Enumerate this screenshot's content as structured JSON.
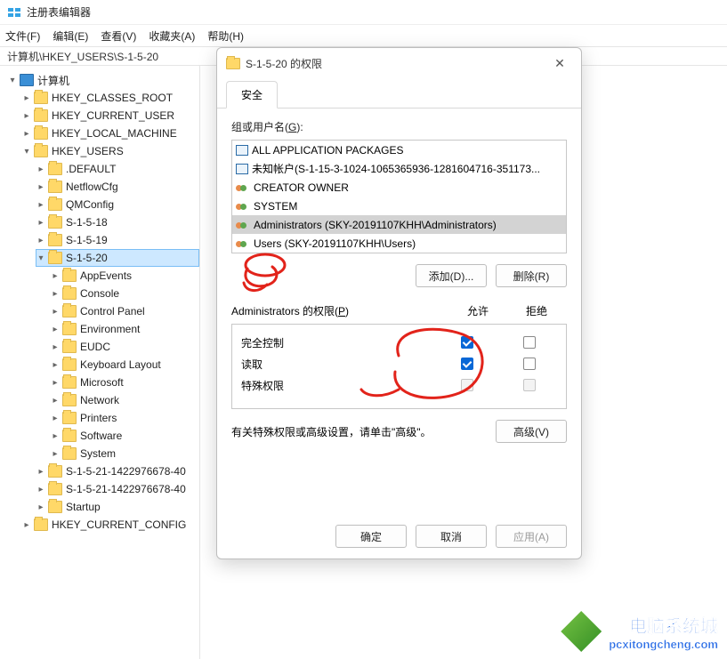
{
  "app": {
    "title": "注册表编辑器"
  },
  "menu": {
    "file": "文件(F)",
    "edit": "编辑(E)",
    "view": "查看(V)",
    "favorites": "收藏夹(A)",
    "help": "帮助(H)"
  },
  "path": "计算机\\HKEY_USERS\\S-1-5-20",
  "tree": {
    "root": "计算机",
    "hkcr": "HKEY_CLASSES_ROOT",
    "hkcu": "HKEY_CURRENT_USER",
    "hklm": "HKEY_LOCAL_MACHINE",
    "hku": "HKEY_USERS",
    "hku_children": [
      ".DEFAULT",
      "NetflowCfg",
      "QMConfig",
      "S-1-5-18",
      "S-1-5-19",
      "S-1-5-20"
    ],
    "s1520_children": [
      "AppEvents",
      "Console",
      "Control Panel",
      "Environment",
      "EUDC",
      "Keyboard Layout",
      "Microsoft",
      "Network",
      "Printers",
      "Software",
      "System"
    ],
    "hku_tail": [
      "S-1-5-21-1422976678-40",
      "S-1-5-21-1422976678-40",
      "Startup"
    ],
    "hkcc": "HKEY_CURRENT_CONFIG"
  },
  "dialog": {
    "title": "S-1-5-20 的权限",
    "tab_security": "安全",
    "group_label_prefix": "组或用户名(",
    "group_label_u": "G",
    "group_label_suffix": "):",
    "principals": [
      {
        "icon": "box",
        "text": "ALL APPLICATION PACKAGES"
      },
      {
        "icon": "box",
        "text": "未知帐户(S-1-15-3-1024-1065365936-1281604716-351173..."
      },
      {
        "icon": "group",
        "text": "CREATOR OWNER"
      },
      {
        "icon": "group",
        "text": "SYSTEM"
      },
      {
        "icon": "group",
        "text": "Administrators (SKY-20191107KHH\\Administrators)",
        "selected": true
      },
      {
        "icon": "group",
        "text": "Users (SKY-20191107KHH\\Users)"
      }
    ],
    "btn_add": "添加(D)...",
    "btn_remove": "删除(R)",
    "perm_header_prefix": "Administrators 的权限(",
    "perm_header_u": "P",
    "perm_header_suffix": ")",
    "col_allow": "允许",
    "col_deny": "拒绝",
    "perms": [
      {
        "name": "完全控制",
        "allow": true,
        "deny": false,
        "allow_dis": false,
        "deny_dis": false
      },
      {
        "name": "读取",
        "allow": true,
        "deny": false,
        "allow_dis": false,
        "deny_dis": false
      },
      {
        "name": "特殊权限",
        "allow": false,
        "deny": false,
        "allow_dis": true,
        "deny_dis": true
      }
    ],
    "adv_text": "有关特殊权限或高级设置，请单击\"高级\"。",
    "btn_advanced": "高级(V)",
    "btn_ok": "确定",
    "btn_cancel": "取消",
    "btn_apply": "应用(A)"
  },
  "watermark": {
    "l1": "电脑系统城",
    "l2": "pcxitongcheng.com"
  }
}
